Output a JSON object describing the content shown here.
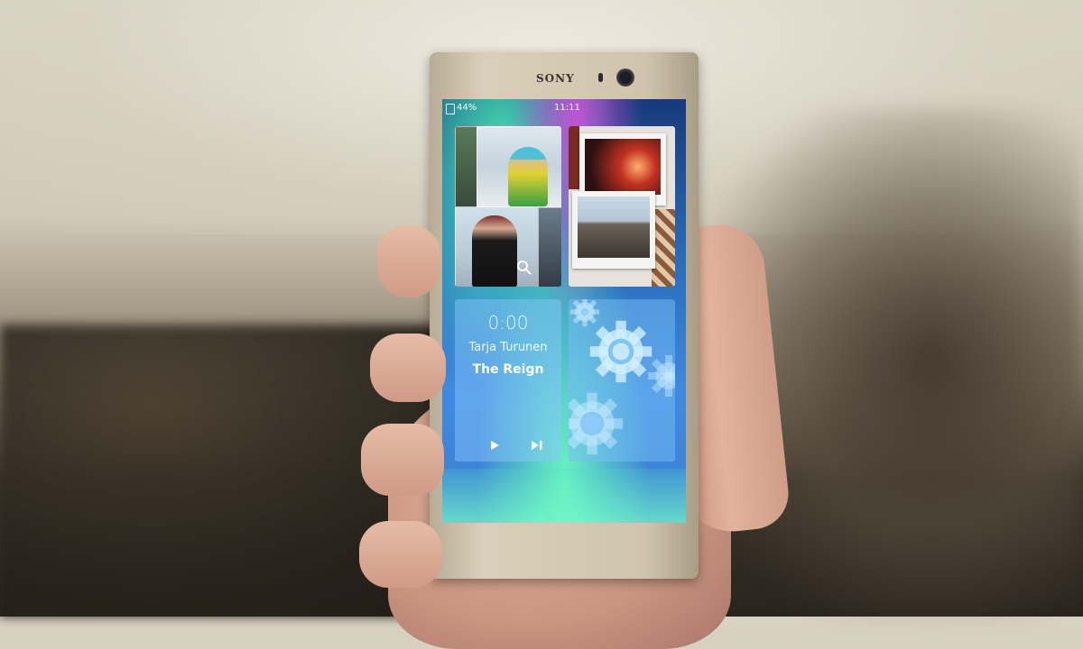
{
  "phone": {
    "brand": "SONY",
    "status_bar": {
      "battery": "44%",
      "time": "11:11"
    },
    "music_tile": {
      "elapsed": "0:00",
      "artist": "Tarja Turunen",
      "track": "The Reign",
      "play_icon": "play-icon",
      "next_icon": "skip-next-icon"
    },
    "photos_tile": {
      "search_icon": "search-icon"
    },
    "settings_tile": {
      "icon": "gear-icon"
    }
  },
  "colors": {
    "screen_accent": "#3f8ae0",
    "aurora_green": "#50ffbe",
    "phone_body": "#d9cfba"
  }
}
